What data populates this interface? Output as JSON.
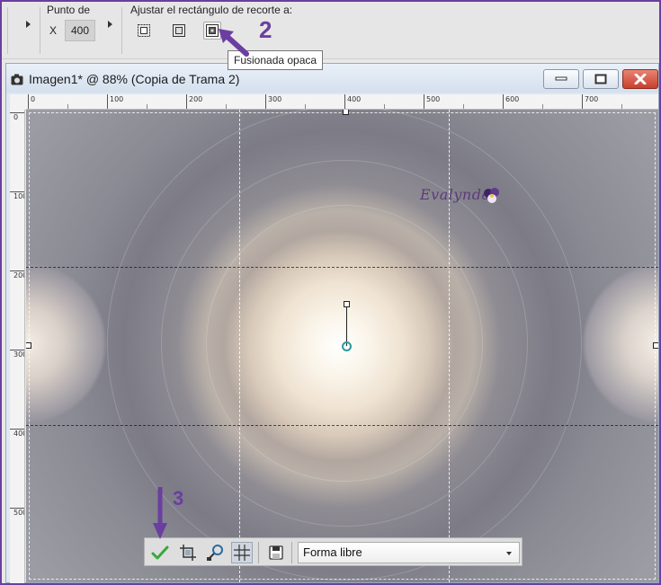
{
  "toolbar": {
    "point_label": "Punto de",
    "x_label": "X",
    "x_value": "400",
    "fit_label": "Ajustar el rectángulo de recorte a:",
    "fit_buttons": [
      {
        "icon": "fit-to-layer-icon"
      },
      {
        "icon": "fit-to-image-icon"
      },
      {
        "icon": "merged-opaque-icon",
        "active": true
      }
    ],
    "tooltip": "Fusionada opaca"
  },
  "annotations": {
    "step2": "2",
    "step3": "3",
    "arrow_color": "#6a3fa0"
  },
  "window": {
    "title": "Imagen1* @  88% (Copia de Trama 2)",
    "buttons": [
      "minimize",
      "maximize",
      "close"
    ]
  },
  "ruler": {
    "horizontal_labels": [
      "0",
      "100",
      "200",
      "300",
      "400",
      "500",
      "600",
      "700"
    ],
    "vertical_labels": [
      "0",
      "100",
      "200",
      "300",
      "400",
      "500"
    ]
  },
  "canvas": {
    "watermark": "Evalynda"
  },
  "cropbar": {
    "buttons": [
      {
        "icon": "apply-checkmark-icon"
      },
      {
        "icon": "crop-as-new-image-icon"
      },
      {
        "icon": "snap-to-icon"
      },
      {
        "icon": "grid-toggle-icon",
        "pressed": true
      },
      {
        "icon": "save-preset-icon"
      }
    ],
    "shape_value": "Forma libre"
  },
  "colors": {
    "accent": "#6a3fa0",
    "close_button": "#c8402c",
    "apply_check": "#3aa83a"
  }
}
